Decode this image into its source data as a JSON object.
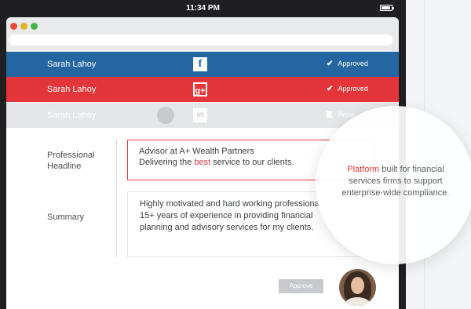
{
  "statusbar": {
    "time": "11:34 PM"
  },
  "rows": [
    {
      "name": "Sarah Lahoy",
      "network_icon": "facebook-icon",
      "network_glyph": "f",
      "status": "Approved"
    },
    {
      "name": "Sarah Lahoy",
      "network_icon": "google-plus-icon",
      "network_glyph": "g+",
      "status": "Approved"
    },
    {
      "name": "Sarah Lahoy",
      "network_icon": "linkedin-icon",
      "network_glyph": "in",
      "status": "Pend"
    }
  ],
  "form": {
    "headline_label_1": "Professional",
    "headline_label_2": "Headline",
    "headline_line1": "Advisor at A+ Wealth Partners",
    "headline_line2_pre": "Delivering the ",
    "headline_line2_highlight": "best",
    "headline_line2_post": "  service to our clients.",
    "summary_label": "Summary",
    "summary_line1": "Highly motivated and hard working professiona",
    "summary_line2": "15+ years of experience in providing financial",
    "summary_line3": "planning and advisory services for my clients."
  },
  "approve_button": "Approve",
  "callout": {
    "highlight": "Platform",
    "line1_rest": " built for financial",
    "line2": "services firms to support",
    "line3": "enterprise-wide compliance."
  },
  "colors": {
    "facebook_blue": "#2366a1",
    "google_red": "#e4363a",
    "pending_grey": "#e5e6e8",
    "accent_red": "#e4363a"
  }
}
